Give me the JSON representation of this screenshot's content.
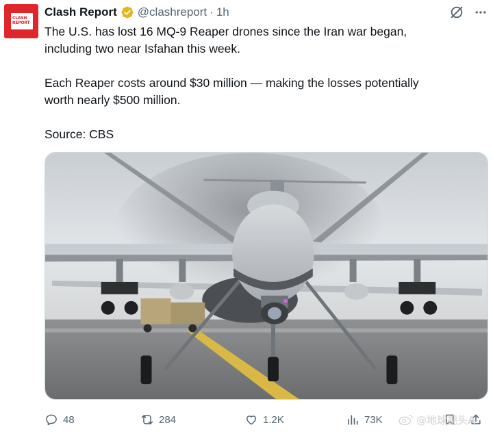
{
  "account": {
    "display_name": "Clash Report",
    "handle": "@clashreport",
    "separator": "·",
    "time": "1h",
    "avatar_text_line1": "CLASH",
    "avatar_text_line2": "REPORT"
  },
  "post": {
    "paragraph1_line1": "The U.S. has lost 16 MQ-9 Reaper drones since the Iran war began,",
    "paragraph1_line2": "including two near Isfahan this week.",
    "paragraph2_line1": "Each Reaper costs around $30 million — making the losses potentially",
    "paragraph2_line2": "worth nearly $500 million.",
    "paragraph3": "Source: CBS"
  },
  "actions": {
    "replies": "48",
    "reposts": "284",
    "likes": "1.2K",
    "views": "73K"
  },
  "watermark": {
    "text": "@地球视头A"
  },
  "colors": {
    "brand_red": "#e0262b",
    "verified_gold": "#e2b719",
    "muted": "#536471",
    "text": "#0f1419"
  }
}
